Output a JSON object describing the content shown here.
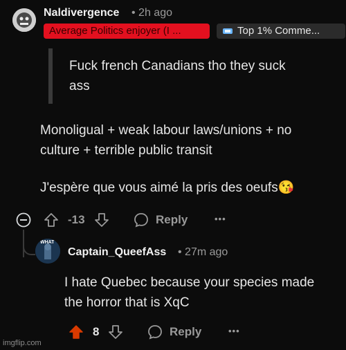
{
  "comment": {
    "username": "Naldivergence",
    "time": "• 2h ago",
    "flair_user": "Average Politics enjoyer (I ...",
    "flair_top": "Top 1% Comme...",
    "quote": [
      "Fuck french Canadians tho they suck",
      "ass"
    ],
    "body": [
      "Monoligual + weak labour laws/unions + no",
      "culture + terrible public transit"
    ],
    "body2": "J'espère que vous aimé la pris des oeufs",
    "emoji": "😘",
    "score": "-13",
    "reply_label": "Reply",
    "more": "•••"
  },
  "reply": {
    "username": "Captain_QueefAss",
    "time": "• 27m ago",
    "avatar_text": "WHAT",
    "body": [
      "I hate Quebec because your species made",
      "the horror that is XqC"
    ],
    "score": "8",
    "reply_label": "Reply",
    "more": "•••"
  },
  "watermark": "imgflip.com",
  "colors": {
    "background": "#0c0c0c",
    "flair_red": "#e3101f",
    "upvote_active": "#d93a00"
  }
}
